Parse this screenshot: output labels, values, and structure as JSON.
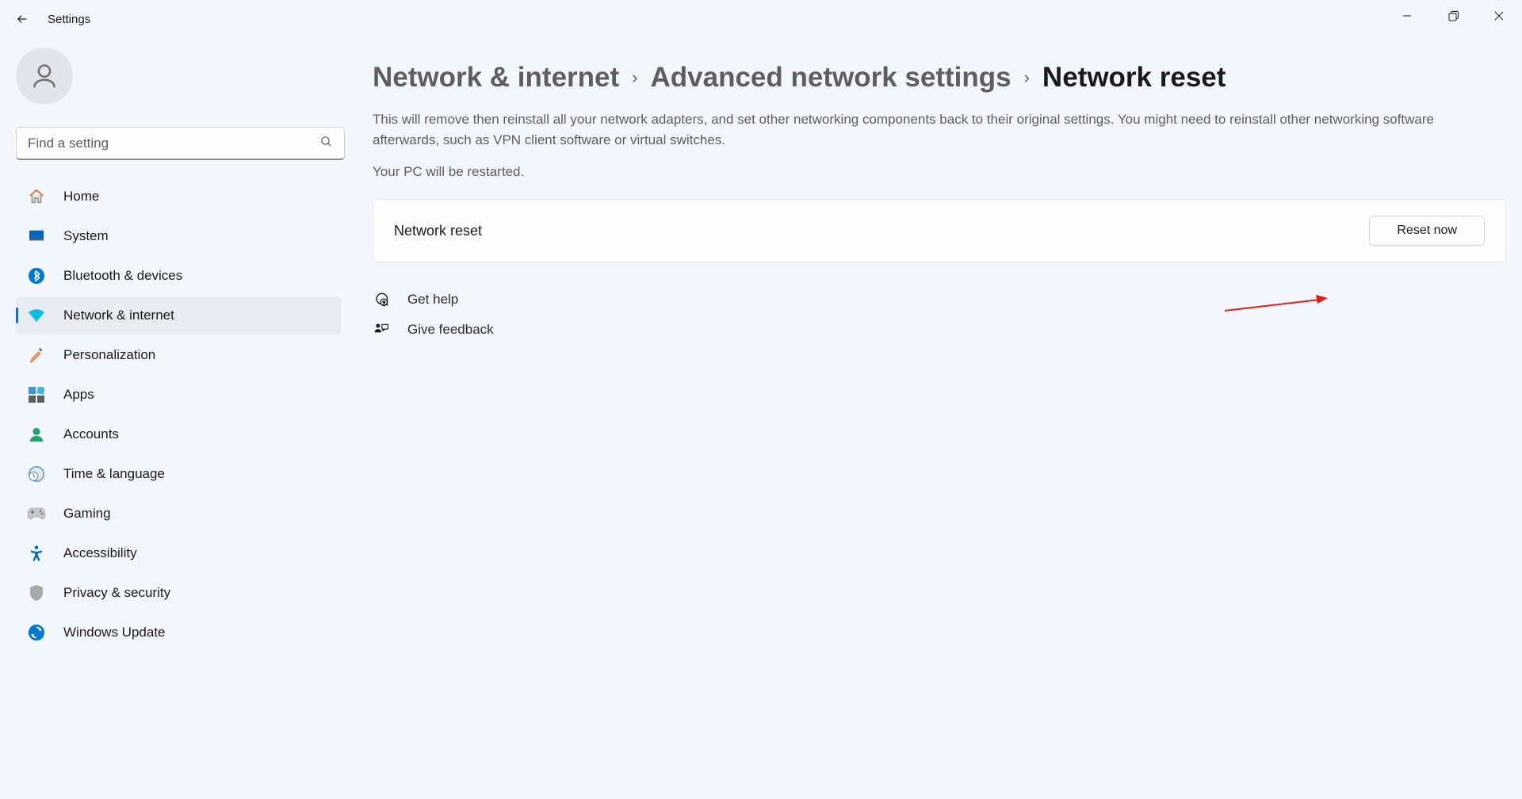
{
  "window": {
    "title": "Settings"
  },
  "search": {
    "placeholder": "Find a setting"
  },
  "sidebar": {
    "items": [
      {
        "label": "Home"
      },
      {
        "label": "System"
      },
      {
        "label": "Bluetooth & devices"
      },
      {
        "label": "Network & internet"
      },
      {
        "label": "Personalization"
      },
      {
        "label": "Apps"
      },
      {
        "label": "Accounts"
      },
      {
        "label": "Time & language"
      },
      {
        "label": "Gaming"
      },
      {
        "label": "Accessibility"
      },
      {
        "label": "Privacy & security"
      },
      {
        "label": "Windows Update"
      }
    ]
  },
  "breadcrumb": {
    "level1": "Network & internet",
    "level2": "Advanced network settings",
    "level3": "Network reset"
  },
  "main": {
    "description": "This will remove then reinstall all your network adapters, and set other networking components back to their original settings. You might need to reinstall other networking software afterwards, such as VPN client software or virtual switches.",
    "restart_note": "Your PC will be restarted.",
    "card_label": "Network reset",
    "reset_button": "Reset now"
  },
  "help": {
    "get_help": "Get help",
    "give_feedback": "Give feedback"
  }
}
